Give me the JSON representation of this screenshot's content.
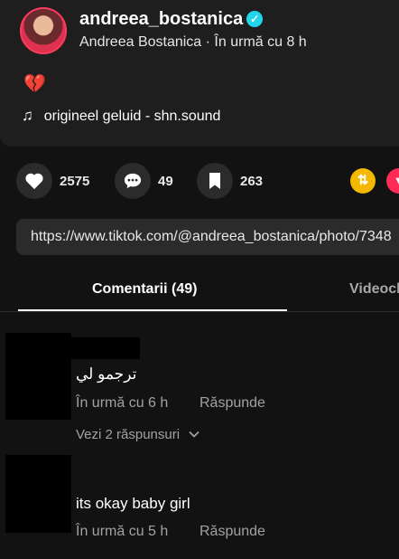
{
  "header": {
    "username": "andreea_bostanica",
    "display_name": "Andreea Bostanica",
    "separator": " · ",
    "posted_time": "În urmă cu 8 h",
    "caption_emoji": "💔",
    "sound_icon": "♫",
    "sound": "origineel geluid - shn.sound"
  },
  "stats": {
    "likes": "2575",
    "comments": "49",
    "saves": "263"
  },
  "share_icons": [
    "repost-icon",
    "pinterest-icon"
  ],
  "link": "https://www.tiktok.com/@andreea_bostanica/photo/7348",
  "tabs": {
    "comments": "Comentarii (49)",
    "videos": "Videoclipuri ale creatorului"
  },
  "comments": [
    {
      "text": "ترجمو لي",
      "time": "În urmă cu 6 h",
      "reply": "Răspunde",
      "replies": "Vezi 2 răspunsuri"
    },
    {
      "text": "its okay baby girl",
      "time": "În urmă cu 5 h",
      "reply": "Răspunde"
    }
  ],
  "colors": {
    "background": "#121212",
    "card": "#1e1e1e",
    "verified": "#20d5ec",
    "heart_emoji": "#ff4f8b",
    "muted_text": "#a2a2a2"
  }
}
